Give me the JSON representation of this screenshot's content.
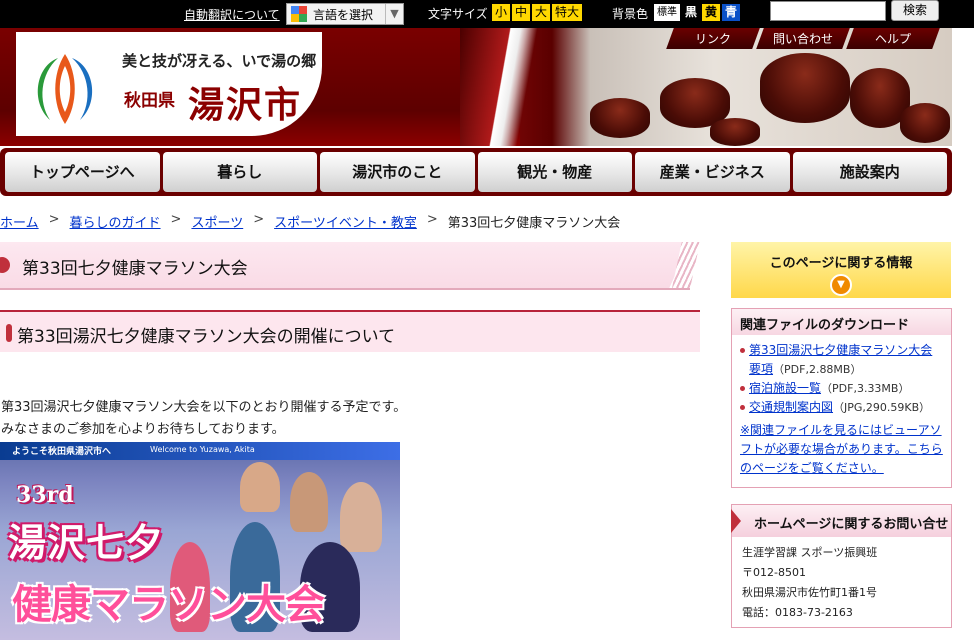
{
  "topbar": {
    "auto_translate": "自動翻訳について",
    "language_select": "言語を選択",
    "font_size_label": "文字サイズ",
    "font_sizes": [
      "小",
      "中",
      "大",
      "特大"
    ],
    "bg_color_label": "背景色",
    "bg_colors": {
      "standard": "標準",
      "black": "黒",
      "yellow": "黄",
      "blue": "青"
    },
    "search_button": "検索",
    "search_value": ""
  },
  "header": {
    "tagline": "美と技が冴える、いで湯の郷",
    "prefecture": "秋田県",
    "city_name": "湯沢市",
    "util_links": [
      "リンク",
      "問い合わせ",
      "ヘルプ"
    ]
  },
  "nav": {
    "items": [
      "トップページへ",
      "暮らし",
      "湯沢市のこと",
      "観光・物産",
      "産業・ビジネス",
      "施設案内"
    ]
  },
  "breadcrumb": {
    "items": [
      "ホーム",
      "暮らしのガイド",
      "スポーツ",
      "スポーツイベント・教室"
    ],
    "separator": ">",
    "current": "第33回七夕健康マラソン大会"
  },
  "page": {
    "title": "第33回七夕健康マラソン大会",
    "subtitle": "第33回湯沢七夕健康マラソン大会の開催について",
    "body_line1": "第33回湯沢七夕健康マラソン大会を以下のとおり開催する予定です。",
    "body_line2": "みなさまのご参加を心よりお待ちしております。"
  },
  "poster": {
    "welcome_ja": "ようこそ秋田県湯沢市へ",
    "welcome_en": "Welcome to Yuzawa, Akita",
    "edition": "33rd",
    "title_line1": "湯沢七夕",
    "title_line2": "健康マラソン大会"
  },
  "sidebar": {
    "page_info_heading": "このページに関する情報",
    "downloads_heading": "関連ファイルのダウンロード",
    "downloads": [
      {
        "label": "第33回湯沢七夕健康マラソン大会要項",
        "meta": "（PDF,2.88MB）"
      },
      {
        "label": "宿泊施設一覧",
        "meta": "（PDF,3.33MB）"
      },
      {
        "label": "交通規制案内図",
        "meta": "（JPG,290.59KB）"
      }
    ],
    "viewer_note": "※関連ファイルを見るにはビューアソフトが必要な場合があります。こちらのページをご覧ください。",
    "contact_heading": "ホームページに関するお問い合せ",
    "contact_dept": "生涯学習課 スポーツ振興班",
    "contact_zip": "〒012-8501",
    "contact_address": "秋田県湯沢市佐竹町1番1号",
    "contact_phone": "電話：0183-73-2163"
  },
  "colors": {
    "brand_red": "#8b0000",
    "accent_yellow": "#ffd800",
    "link_blue": "#0033cc"
  }
}
